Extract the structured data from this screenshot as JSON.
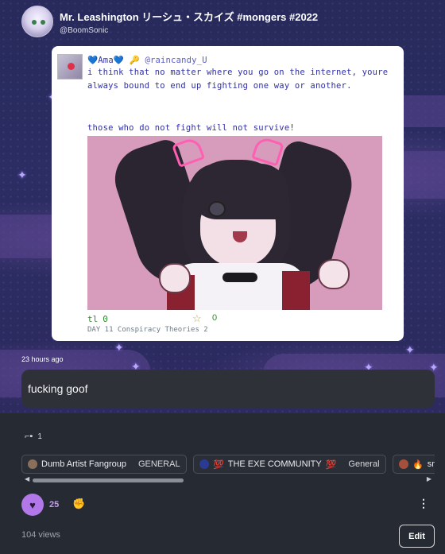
{
  "header": {
    "display_name": "Mr. Leashington リーシュ・スカイズ #mongers #2022",
    "handle": "@BoomSonic"
  },
  "embedded_post": {
    "author_name": "💙Ama💙 🔑",
    "author_handle": "@raincandy_U",
    "line1": "i think that no matter where you go on the internet, youre",
    "line2": "always bound to end up fighting one way or another.",
    "line3": "those who do not fight will not survive!",
    "retweet_icon": "tl",
    "retweet_count": "0",
    "star_icon": "☆",
    "extra_count": "0",
    "footer": "DAY 11 Conspiracy Theories 2"
  },
  "post": {
    "timestamp": "23 hours ago",
    "caption": "fucking goof"
  },
  "reaction": {
    "icon": "sunglasses-emoji",
    "glyph": "⌐▪",
    "count": "1"
  },
  "communities": [
    {
      "name": "Dumb Artist Fangroup",
      "tag": "GENERAL",
      "emoji": ""
    },
    {
      "name": "THE EXE COMMUNITY",
      "tag": "General",
      "emoji": "💯"
    },
    {
      "name": "smug scarl",
      "tag": "",
      "emoji": "🔥"
    }
  ],
  "actions": {
    "like_count": "25",
    "views": "104 views",
    "edit_label": "Edit"
  },
  "colors": {
    "accent_purple": "#b277e8",
    "background": "#262b33",
    "pixel_text": "#2f2fa8"
  }
}
